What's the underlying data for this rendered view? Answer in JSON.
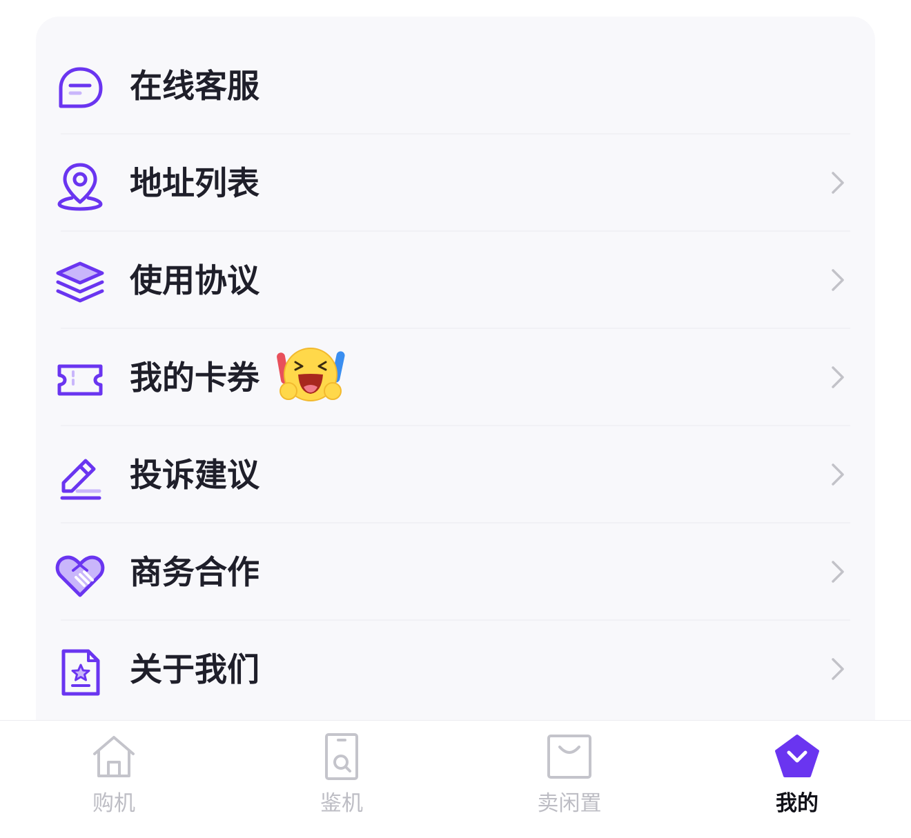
{
  "menu": {
    "items": [
      {
        "label": "在线客服",
        "icon": "chat-bubble-icon",
        "chevron": false
      },
      {
        "label": "地址列表",
        "icon": "location-pin-icon",
        "chevron": true
      },
      {
        "label": "使用协议",
        "icon": "layers-icon",
        "chevron": true
      },
      {
        "label": "我的卡券",
        "icon": "ticket-icon",
        "chevron": true,
        "badge": "cheering-emoji"
      },
      {
        "label": "投诉建议",
        "icon": "edit-pencil-icon",
        "chevron": true
      },
      {
        "label": "商务合作",
        "icon": "handshake-heart-icon",
        "chevron": true
      },
      {
        "label": "关于我们",
        "icon": "document-star-icon",
        "chevron": true
      }
    ]
  },
  "tabbar": {
    "tabs": [
      {
        "label": "购机",
        "icon": "home-icon",
        "active": false
      },
      {
        "label": "鉴机",
        "icon": "phone-inspect-icon",
        "active": false
      },
      {
        "label": "卖闲置",
        "icon": "shopping-bag-icon",
        "active": false
      },
      {
        "label": "我的",
        "icon": "diamond-chevron-icon",
        "active": true
      }
    ]
  },
  "colors": {
    "accent": "#6a35f0",
    "accent_light": "#c9b6fb",
    "text": "#1f1f2a",
    "tab_inactive": "#bdbdc4",
    "card_bg": "#f8f8fb"
  }
}
